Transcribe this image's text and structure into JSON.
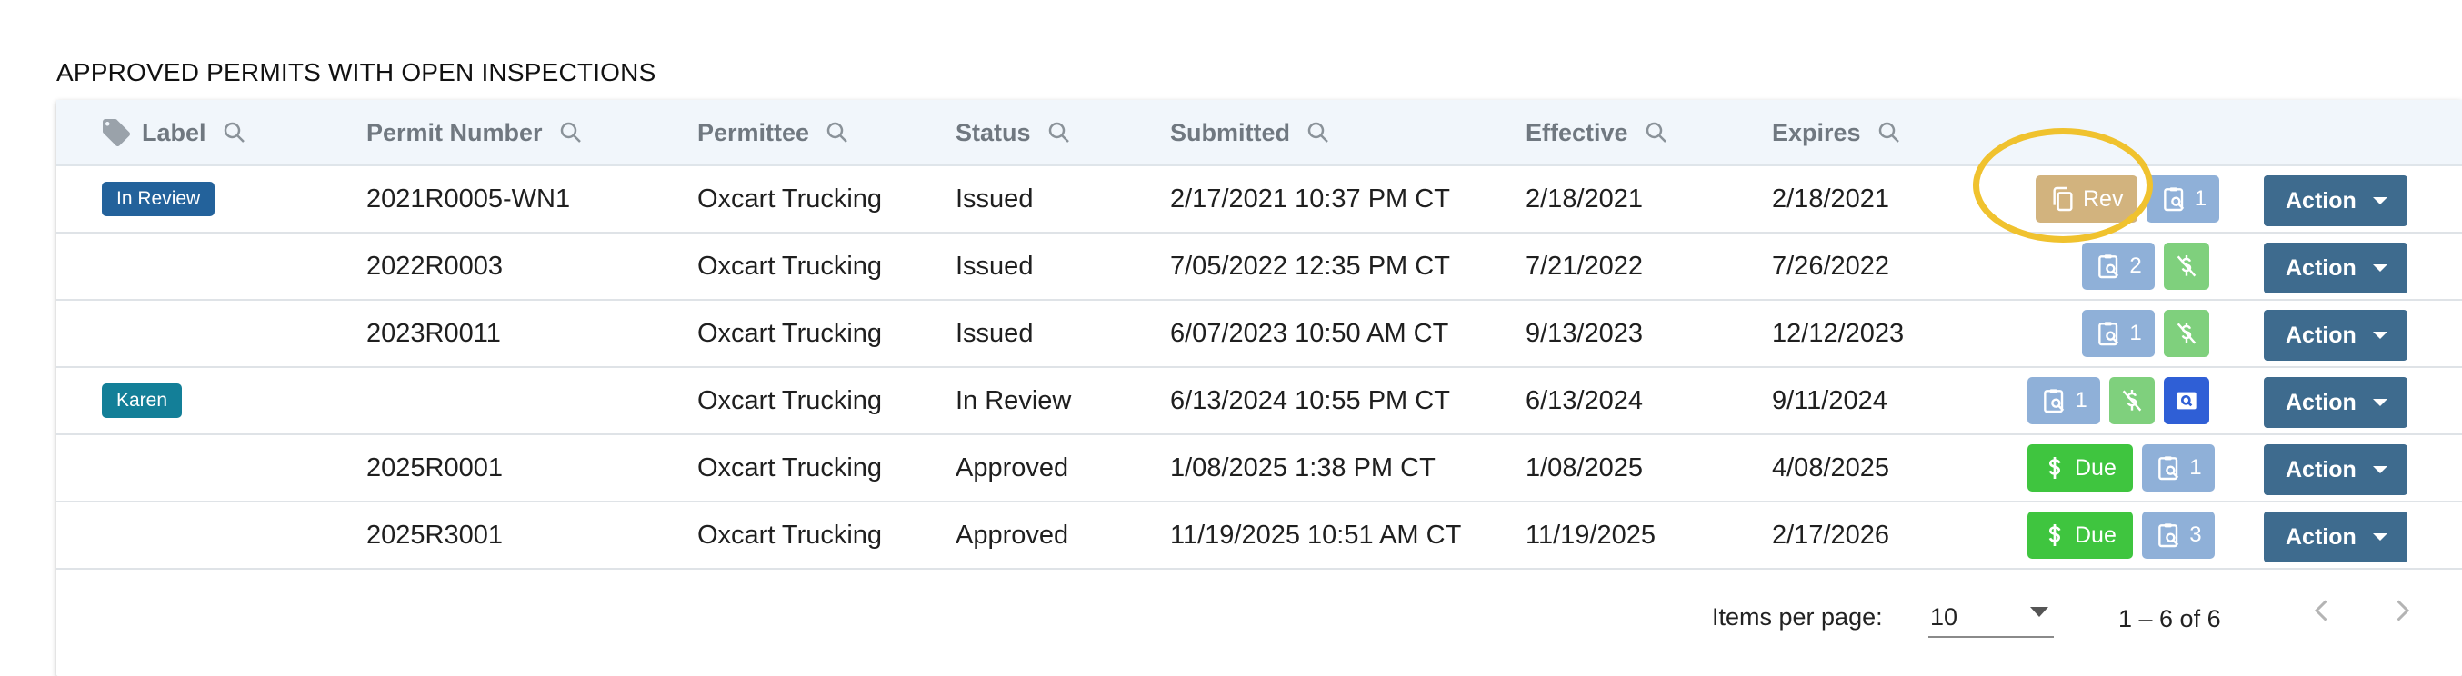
{
  "page": {
    "title": "APPROVED PERMITS WITH OPEN INSPECTIONS"
  },
  "columns": [
    "Label",
    "Permit Number",
    "Permittee",
    "Status",
    "Submitted",
    "Effective",
    "Expires"
  ],
  "colors": {
    "label_in_review": "#23629b",
    "label_karen": "#137f98",
    "action": "#3e6b8e",
    "highlight": "#f0c22e"
  },
  "rows": [
    {
      "label": "In Review",
      "label_color": "#23629b",
      "permit": "2021R0005-WN1",
      "permittee": "Oxcart Trucking",
      "status": "Issued",
      "submitted": "2/17/2021 10:37 PM CT",
      "effective": "2/18/2021",
      "expires": "2/18/2021",
      "rev_label": "Rev",
      "insp_count": "1",
      "action": "Action"
    },
    {
      "label": "",
      "permit": "2022R0003",
      "permittee": "Oxcart Trucking",
      "status": "Issued",
      "submitted": "7/05/2022 12:35 PM CT",
      "effective": "7/21/2022",
      "expires": "7/26/2022",
      "insp_count": "2",
      "action": "Action"
    },
    {
      "label": "",
      "permit": "2023R0011",
      "permittee": "Oxcart Trucking",
      "status": "Issued",
      "submitted": "6/07/2023 10:50 AM CT",
      "effective": "9/13/2023",
      "expires": "12/12/2023",
      "insp_count": "1",
      "action": "Action"
    },
    {
      "label": "Karen",
      "label_color": "#137f98",
      "permit": "",
      "permittee": "Oxcart Trucking",
      "status": "In Review",
      "submitted": "6/13/2024 10:55 PM CT",
      "effective": "6/13/2024",
      "expires": "9/11/2024",
      "insp_count": "1",
      "action": "Action"
    },
    {
      "label": "",
      "permit": "2025R0001",
      "permittee": "Oxcart Trucking",
      "status": "Approved",
      "submitted": "1/08/2025 1:38 PM CT",
      "effective": "1/08/2025",
      "expires": "4/08/2025",
      "due_label": "Due",
      "insp_count": "1",
      "action": "Action"
    },
    {
      "label": "",
      "permit": "2025R3001",
      "permittee": "Oxcart Trucking",
      "status": "Approved",
      "submitted": "11/19/2025 10:51 AM CT",
      "effective": "11/19/2025",
      "expires": "2/17/2026",
      "due_label": "Due",
      "insp_count": "3",
      "action": "Action"
    }
  ],
  "pagination": {
    "items_per_page_label": "Items per page:",
    "page_size": "10",
    "range": "1 – 6 of 6"
  },
  "icons": {
    "label_column": "tag-icon",
    "search": "search-icon",
    "inspection": "clipboard-search-icon",
    "fee_paid": "dollar-slash-icon",
    "due": "dollar-icon",
    "rev": "copy-icon",
    "view": "magnify-doc-icon",
    "prev": "chevron-left-icon",
    "next": "chevron-right-icon"
  }
}
